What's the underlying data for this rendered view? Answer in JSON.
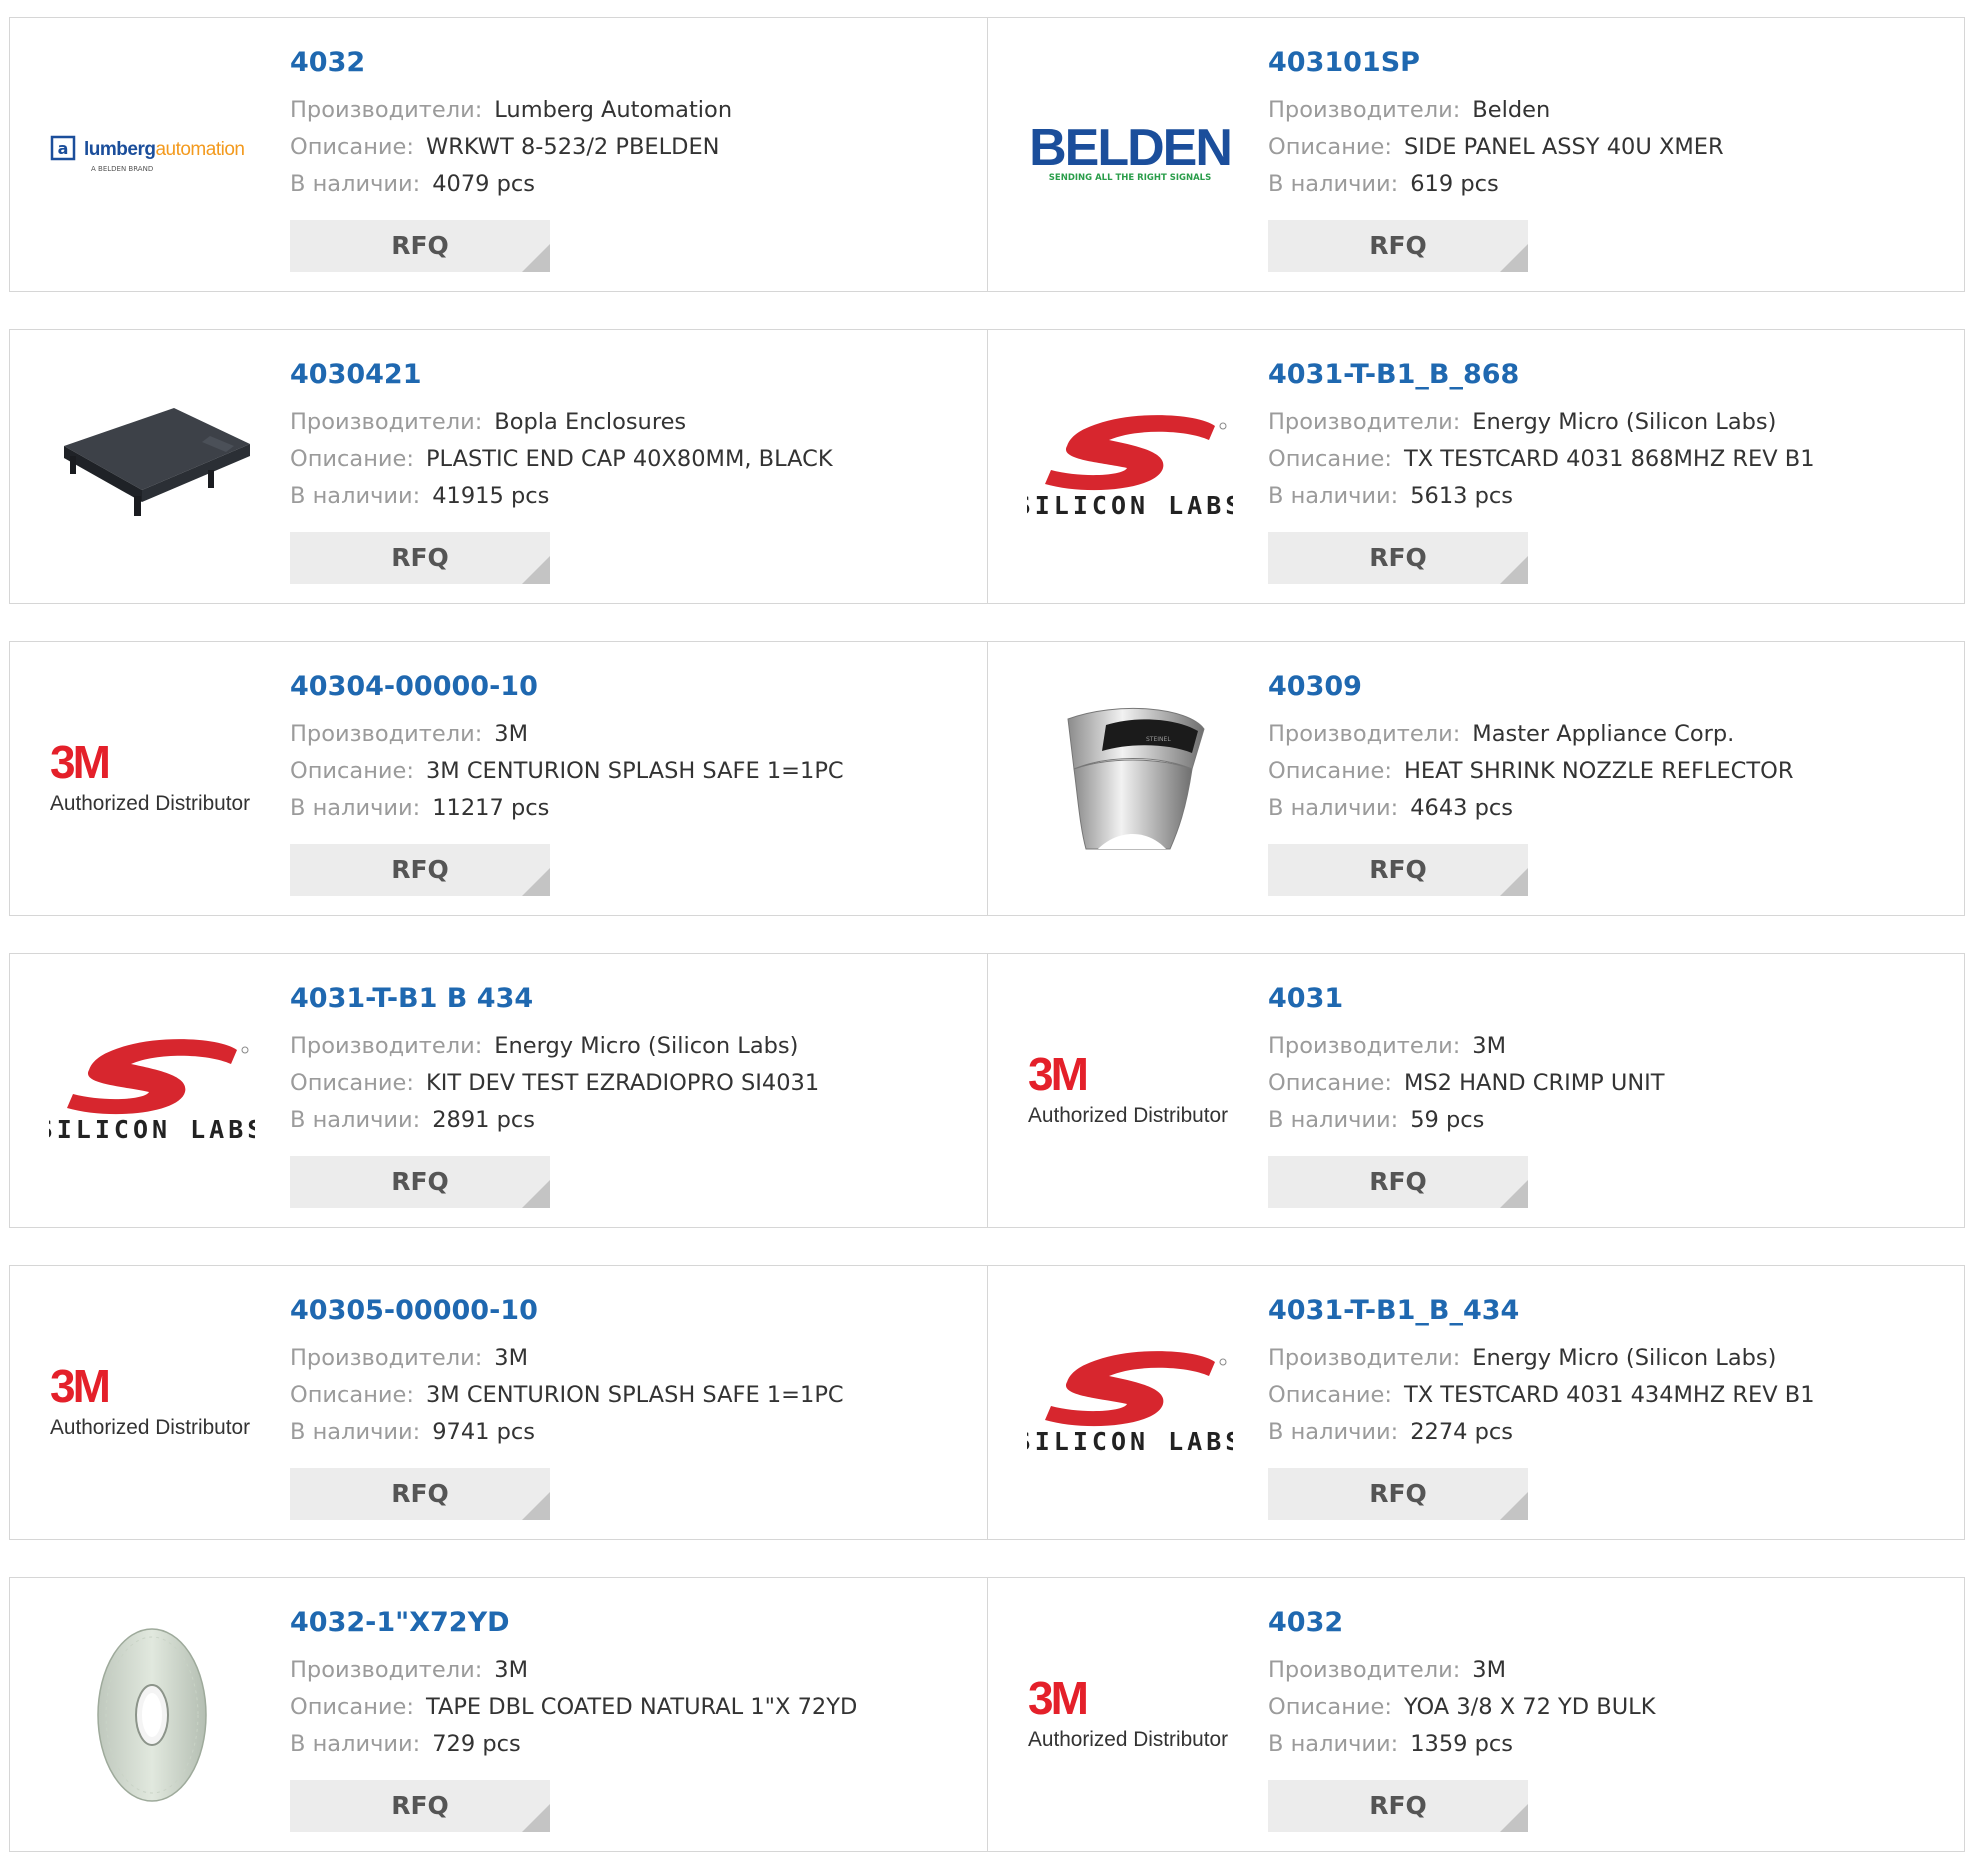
{
  "labels": {
    "manufacturer": "Производители:",
    "description": "Описание:",
    "stock": "В наличии:",
    "rfq": "RFQ"
  },
  "logos": {
    "lumberg_main": "lumberg",
    "lumberg_accent": "automation",
    "lumberg_sub": "A BELDEN BRAND",
    "belden_main": "BELDEN",
    "belden_tagline": "SENDING ALL THE RIGHT SIGNALS",
    "silicon_labs": "SILICON LABS",
    "three_m": "3M",
    "three_m_sub": "Authorized Distributor",
    "nozzle_print": "STEINEL"
  },
  "products": [
    {
      "part": "4032",
      "manufacturer": "Lumberg Automation",
      "description": "WRKWT 8-523/2 PBELDEN",
      "stock": "4079 pcs",
      "image": "lumberg-logo"
    },
    {
      "part": "403101SP",
      "manufacturer": "Belden",
      "description": "SIDE PANEL ASSY 40U XMER",
      "stock": "619 pcs",
      "image": "belden-logo"
    },
    {
      "part": "4030421",
      "manufacturer": "Bopla Enclosures",
      "description": "PLASTIC END CAP 40X80MM, BLACK",
      "stock": "41915 pcs",
      "image": "end-cap-photo"
    },
    {
      "part": "4031-T-B1_B_868",
      "manufacturer": "Energy Micro (Silicon Labs)",
      "description": "TX TESTCARD 4031 868MHZ REV B1",
      "stock": "5613 pcs",
      "image": "silicon-labs-logo"
    },
    {
      "part": "40304-00000-10",
      "manufacturer": "3M",
      "description": "3M CENTURION SPLASH SAFE 1=1PC",
      "stock": "11217 pcs",
      "image": "3m-logo"
    },
    {
      "part": "40309",
      "manufacturer": "Master Appliance Corp.",
      "description": "HEAT SHRINK NOZZLE REFLECTOR",
      "stock": "4643 pcs",
      "image": "nozzle-reflector-photo"
    },
    {
      "part": "4031-T-B1 B 434",
      "manufacturer": "Energy Micro (Silicon Labs)",
      "description": "KIT DEV TEST EZRADIOPRO SI4031",
      "stock": "2891 pcs",
      "image": "silicon-labs-logo"
    },
    {
      "part": "4031",
      "manufacturer": "3M",
      "description": "MS2 HAND CRIMP UNIT",
      "stock": "59 pcs",
      "image": "3m-logo"
    },
    {
      "part": "40305-00000-10",
      "manufacturer": "3M",
      "description": "3M CENTURION SPLASH SAFE 1=1PC",
      "stock": "9741 pcs",
      "image": "3m-logo"
    },
    {
      "part": "4031-T-B1_B_434",
      "manufacturer": "Energy Micro (Silicon Labs)",
      "description": "TX TESTCARD 4031 434MHZ REV B1",
      "stock": "2274 pcs",
      "image": "silicon-labs-logo"
    },
    {
      "part": "4032-1\"X72YD",
      "manufacturer": "3M",
      "description": "TAPE DBL COATED NATURAL 1\"X 72YD",
      "stock": "729 pcs",
      "image": "tape-roll-photo"
    },
    {
      "part": "4032",
      "manufacturer": "3M",
      "description": "YOA 3/8 X 72 YD BULK",
      "stock": "1359 pcs",
      "image": "3m-logo"
    }
  ],
  "colors": {
    "link": "#1f68b0",
    "label": "#9b9b9b",
    "value": "#333333",
    "button_bg": "#ececec",
    "border": "#d6d6d6",
    "three_m_red": "#e4202a",
    "silicon_red": "#d7262e",
    "belden_blue": "#1b4e9b"
  }
}
